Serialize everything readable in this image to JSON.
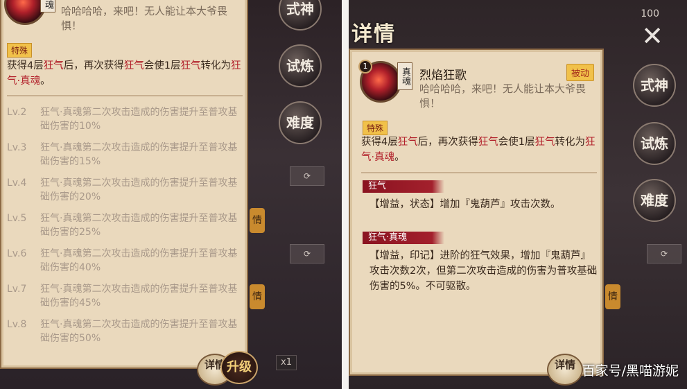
{
  "left": {
    "quote": "哈哈哈哈，来吧！无人能让本大爷畏惧！",
    "avatar_tag": "魂",
    "special_tag": "特殊",
    "desc_parts": [
      "获得4层",
      "狂气",
      "后，再次获得",
      "狂气",
      "会使1层",
      "狂气",
      "转化为",
      "狂气·真魂",
      "。"
    ],
    "levels": [
      {
        "lv": "Lv.2",
        "text": "狂气·真魂第二次攻击造成的伤害提升至普攻基础伤害的10%"
      },
      {
        "lv": "Lv.3",
        "text": "狂气·真魂第二次攻击造成的伤害提升至普攻基础伤害的15%"
      },
      {
        "lv": "Lv.4",
        "text": "狂气·真魂第二次攻击造成的伤害提升至普攻基础伤害的20%"
      },
      {
        "lv": "Lv.5",
        "text": "狂气·真魂第二次攻击造成的伤害提升至普攻基础伤害的25%"
      },
      {
        "lv": "Lv.6",
        "text": "狂气·真魂第二次攻击造成的伤害提升至普攻基础伤害的40%"
      },
      {
        "lv": "Lv.7",
        "text": "狂气·真魂第二次攻击造成的伤害提升至普攻基础伤害的45%"
      },
      {
        "lv": "Lv.8",
        "text": "狂气·真魂第二次攻击造成的伤害提升至普攻基础伤害的50%"
      }
    ],
    "side_buttons": [
      "式神",
      "试炼",
      "难度"
    ],
    "detail_label": "详情",
    "upgrade_label": "升级",
    "count": "x1"
  },
  "right": {
    "title": "详情",
    "top_num": "100",
    "skill_level": "1",
    "avatar_tag": "真魂",
    "skill_name": "烈焰狂歌",
    "passive": "被动",
    "quote": "哈哈哈哈，来吧！无人能让本大爷畏惧！",
    "special_tag": "特殊",
    "desc_parts": [
      "获得4层",
      "狂气",
      "后，再次获得",
      "狂气",
      "会使1层",
      "狂气",
      "转化为",
      "狂气·真魂",
      "。"
    ],
    "section1_title": "狂气",
    "section1_text": "【增益，状态】增加『鬼葫芦』攻击次数。",
    "section2_title": "狂气·真魂",
    "section2_text": "【增益，印记】进阶的狂气效果，增加『鬼葫芦』攻击次数2次，但第二次攻击造成的伤害为普攻基础伤害的5%。不可驱散。",
    "side_buttons": [
      "式神",
      "试炼",
      "难度"
    ],
    "detail_label": "详情"
  },
  "watermark": "百家号/黑喵游妮",
  "colors": {
    "keyword_red": "#b2202a",
    "paper": "#ead9bd",
    "gold_tag": "#f1c14a"
  }
}
